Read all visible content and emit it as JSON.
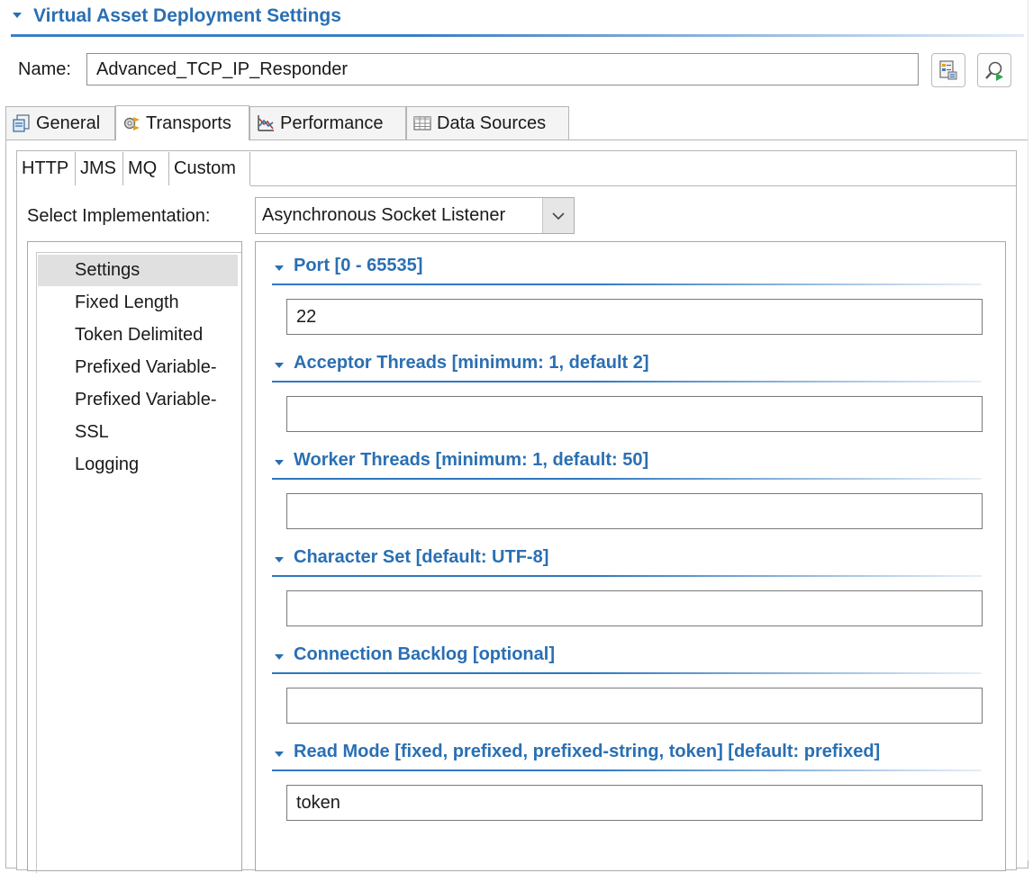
{
  "header": {
    "title": "Virtual Asset Deployment Settings"
  },
  "name_row": {
    "label": "Name:",
    "value": "Advanced_TCP_IP_Responder"
  },
  "toolbar": {
    "browse_icon": "properties-icon",
    "preview_icon": "search-run-icon"
  },
  "outer_tabs": [
    {
      "label": "General",
      "icon": "general-icon"
    },
    {
      "label": "Transports",
      "icon": "transports-icon",
      "active": true
    },
    {
      "label": "Performance",
      "icon": "performance-chart-icon"
    },
    {
      "label": "Data Sources",
      "icon": "table-icon"
    }
  ],
  "inner_tabs": [
    {
      "label": "HTTP"
    },
    {
      "label": "JMS"
    },
    {
      "label": "MQ"
    },
    {
      "label": "Custom",
      "active": true
    }
  ],
  "implementation": {
    "label": "Select Implementation:",
    "value": "Asynchronous Socket Listener"
  },
  "nav": {
    "items": [
      {
        "label": "Settings",
        "selected": true
      },
      {
        "label": "Fixed Length"
      },
      {
        "label": "Token Delimited"
      },
      {
        "label": "Prefixed Variable-"
      },
      {
        "label": "Prefixed Variable-"
      },
      {
        "label": "SSL"
      },
      {
        "label": "Logging"
      }
    ]
  },
  "sections": [
    {
      "title": "Port [0 - 65535]",
      "value": "22"
    },
    {
      "title": "Acceptor Threads [minimum: 1, default 2]",
      "value": ""
    },
    {
      "title": "Worker Threads [minimum: 1, default: 50]",
      "value": ""
    },
    {
      "title": "Character Set [default: UTF-8]",
      "value": ""
    },
    {
      "title": "Connection Backlog [optional]",
      "value": ""
    },
    {
      "title": "Read Mode [fixed, prefixed, prefixed-string, token] [default: prefixed]",
      "value": "token"
    }
  ],
  "colors": {
    "accent": "#2a6fb3",
    "selection": "#e0e0e0",
    "border": "#b5b5b5"
  }
}
